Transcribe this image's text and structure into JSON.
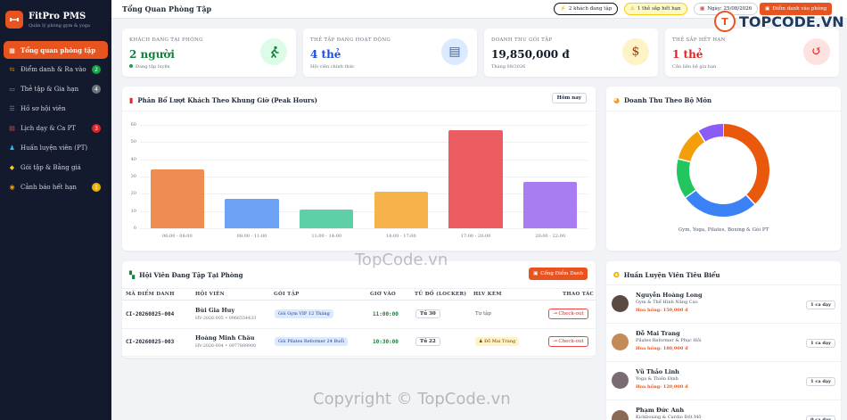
{
  "brand": {
    "name": "FitPro PMS",
    "subtitle": "Quản lý phòng gym & yoga",
    "logo_icon": "dumbbell-icon"
  },
  "sidebar": {
    "items": [
      {
        "label": "Tổng quan phòng tập",
        "icon": "grid-icon",
        "badge": null,
        "active": true
      },
      {
        "label": "Điểm danh & Ra vào",
        "icon": "checkin-icon",
        "badge": "2",
        "badge_color": "#16a34a"
      },
      {
        "label": "Thẻ tập & Gia hạn",
        "icon": "card-icon",
        "badge": "4",
        "badge_color": "#6b7280"
      },
      {
        "label": "Hồ sơ hội viên",
        "icon": "members-icon",
        "badge": null
      },
      {
        "label": "Lịch dạy & Ca PT",
        "icon": "calendar-icon",
        "badge": "3",
        "badge_color": "#dc2626"
      },
      {
        "label": "Huấn luyện viên (PT)",
        "icon": "trainer-icon",
        "badge": null
      },
      {
        "label": "Gói tập & Bảng giá",
        "icon": "tag-icon",
        "badge": null
      },
      {
        "label": "Cảnh báo hết hạn",
        "icon": "bell-icon",
        "badge": "1",
        "badge_color": "#eab308"
      }
    ]
  },
  "header": {
    "title": "Tổng Quan Phòng Tập",
    "pill_active": "2 khách đang tập",
    "pill_expiring": "1 thẻ sắp hết hạn",
    "date": "Ngày: 25/08/2026",
    "checkin_button": "Điểm danh vào phòng"
  },
  "stats": [
    {
      "label": "KHÁCH ĐANG TẠI PHÒNG",
      "value": "2 người",
      "sub": "Đang tập luyện",
      "value_color": "#15803d",
      "icon": "running-icon",
      "icon_bg": "#dcfce7",
      "icon_color": "#15803d"
    },
    {
      "label": "THẺ TẬP ĐANG HOẠT ĐỘNG",
      "value": "4 thẻ",
      "sub": "Hội viên chính thức",
      "value_color": "#1d4ed8",
      "icon": "id-card-icon",
      "icon_bg": "#dbeafe",
      "icon_color": "#2563eb"
    },
    {
      "label": "DOANH THU GÓI TẬP",
      "value": "19,850,000 đ",
      "sub": "Tháng 08/2026",
      "value_color": "#111827",
      "icon": "money-bag-icon",
      "icon_bg": "#fef3c7",
      "icon_color": "#92400e"
    },
    {
      "label": "THẺ SẮP HẾT HẠN",
      "value": "1 thẻ",
      "sub": "Cần liên hệ gia hạn",
      "value_color": "#dc2626",
      "icon": "history-icon",
      "icon_bg": "#fee2e2",
      "icon_color": "#dc2626"
    }
  ],
  "peak_chart": {
    "title": "Phân Bổ Lượt Khách Theo Khung Giờ (Peak Hours)",
    "button": "Hôm nay",
    "icon": "bar-chart-icon"
  },
  "chart_data": [
    {
      "type": "bar",
      "title": "Phân Bổ Lượt Khách Theo Khung Giờ (Peak Hours)",
      "categories": [
        "06:00 - 08:00",
        "08:00 - 11:00",
        "11:00 - 14:00",
        "14:00 - 17:00",
        "17:00 - 20:00",
        "20:00 - 22:00"
      ],
      "values": [
        34,
        17,
        11,
        21,
        57,
        27
      ],
      "colors": [
        "#ef8c52",
        "#6ea2f5",
        "#5fcfa5",
        "#f6b34c",
        "#ec5d62",
        "#a97cf2"
      ],
      "ylim": [
        0,
        60
      ],
      "yticks": [
        0,
        10,
        20,
        30,
        40,
        50,
        60
      ],
      "grid": true
    },
    {
      "type": "pie",
      "title": "Doanh Thu Theo Bộ Môn",
      "caption": "Gym, Yoga, Pilates, Boxing & Gói PT",
      "values": [
        38,
        27,
        14,
        12,
        9
      ],
      "colors": [
        "#ea580c",
        "#3b82f6",
        "#22c55e",
        "#f59e0b",
        "#8b5cf6"
      ]
    }
  ],
  "revenue_panel": {
    "title": "Doanh Thu Theo Bộ Môn",
    "icon": "pie-chart-icon",
    "caption": "Gym, Yoga, Pilates, Boxing & Gói PT"
  },
  "members_panel": {
    "title": "Hội Viên Đang Tập Tại Phòng",
    "icon": "door-icon",
    "button": "Cổng Điểm Danh",
    "columns": [
      "MÃ ĐIỂM DANH",
      "HỘI VIÊN",
      "GÓI TẬP",
      "GIỜ VÀO",
      "TỦ ĐỒ (LOCKER)",
      "HLV KÈM",
      "THAO TÁC"
    ],
    "rows": [
      {
        "code": "CI-20260825-004",
        "name": "Bùi Gia Huy",
        "meta": "HV-2026-005 • 0966554433",
        "package": "Gói Gym VIP 12 Tháng",
        "time": "11:00:00",
        "locker": "Tủ 30",
        "coach": "Tự tập",
        "coach_tag": false,
        "action": "Check-out"
      },
      {
        "code": "CI-20260825-003",
        "name": "Hoàng Minh Châu",
        "meta": "HV-2026-004 • 0977889900",
        "package": "Gói Pilates Reformer 24 Buổi",
        "time": "10:30:00",
        "locker": "Tủ 22",
        "coach": "Đỗ Mai Trang",
        "coach_tag": true,
        "action": "Check-out"
      }
    ]
  },
  "trainers_panel": {
    "title": "Huấn Luyện Viên Tiêu Biểu",
    "icon": "medal-icon",
    "items": [
      {
        "name": "Nguyễn Hoàng Long",
        "spec": "Gym & Thể Hình Nâng Cao",
        "commission": "Hoa hồng: 150,000 đ",
        "shift": "1 ca dạy"
      },
      {
        "name": "Đỗ Mai Trang",
        "spec": "Pilates Reformer & Phục Hồi",
        "commission": "Hoa hồng: 180,000 đ",
        "shift": "1 ca dạy"
      },
      {
        "name": "Vũ Thảo Linh",
        "spec": "Yoga & Thiền Định",
        "commission": "Hoa hồng: 120,000 đ",
        "shift": "1 ca dạy"
      },
      {
        "name": "Phạm Đức Anh",
        "spec": "Kickboxing & Cardio Đốt Mỡ",
        "commission": "",
        "shift": "0 ca dạy"
      }
    ]
  },
  "watermarks": {
    "logo_text": "TOPCODE.VN",
    "center": "TopCode.vn",
    "bottom": "Copyright © TopCode.vn"
  }
}
